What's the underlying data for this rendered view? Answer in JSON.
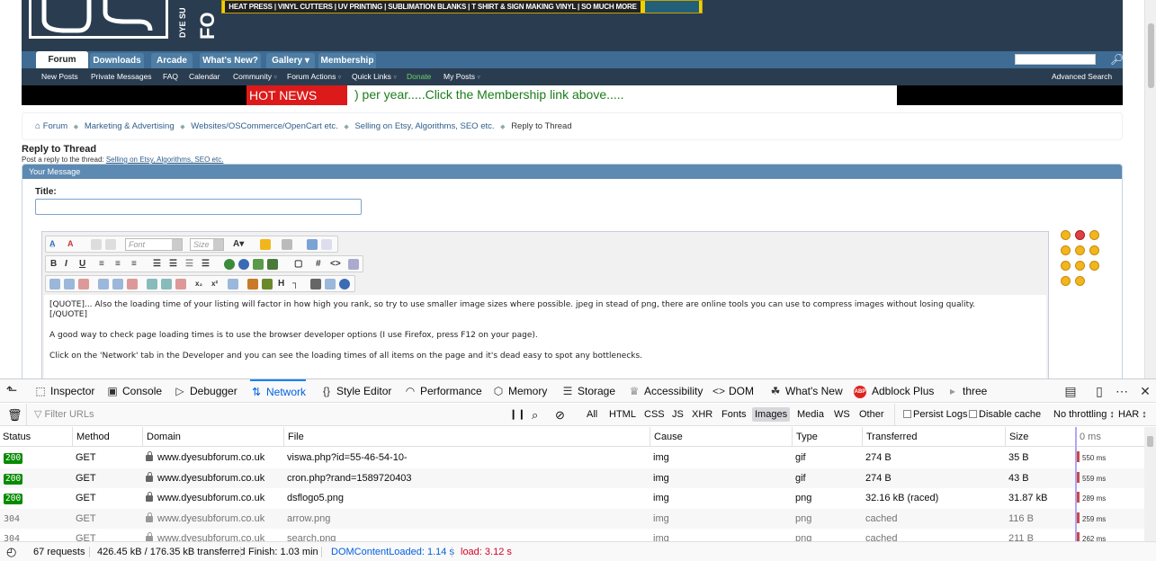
{
  "site": {
    "logo_side_text": "DYE SU",
    "logo_side_big": "FO",
    "banner_text": "HEAT PRESS | VINYL CUTTERS | UV PRINTING | SUBLIMATION BLANKS | T SHIRT & SIGN MAKING VINYL | SO MUCH MORE",
    "nav_tabs": [
      "Forum",
      "Downloads",
      "Arcade",
      "What's New?",
      "Gallery ▾",
      "Membership"
    ],
    "subnav": [
      "New Posts",
      "Private Messages",
      "FAQ",
      "Calendar",
      "Community",
      "Forum Actions",
      "Quick Links",
      "Donate",
      "My Posts"
    ],
    "advanced_search": "Advanced Search",
    "news_label": "HOT NEWS",
    "news_text": ") per year.....Click the Membership link above.....",
    "breadcrumb": [
      "Forum",
      "Marketing & Advertising",
      "Websites/OSCommerce/OpenCart etc.",
      "Selling on Etsy, Algorithms, SEO etc.",
      "Reply to Thread"
    ],
    "reply_title": "Reply to Thread",
    "reply_sub_prefix": "Post a reply to the thread: ",
    "reply_sub_link": "Selling on Etsy, Algorithms, SEO etc.",
    "your_message": "Your Message",
    "title_label": "Title:",
    "title_value": "",
    "font_placeholder": "Font",
    "size_placeholder": "Size",
    "editor_lines": [
      "[QUOTE]... Also the loading time of your listing will factor in how high you rank, so try to use smaller image sizes where possible. jpeg in stead of png, there are online tools you can use to compress images without losing quality.",
      "[/QUOTE]",
      "A good way to check page loading times is to use the browser developer options (I use Firefox, press F12 on your page).",
      "Click on the 'Network' tab in the Developer and you can see the loading times of all items on the page and it's dead easy to spot any bottlenecks."
    ],
    "colors": {
      "header": "#2a3d50",
      "nav": "#3e6c94",
      "hot_news": "#dd1a1a",
      "news_text": "#1b7d1b"
    }
  },
  "devtools": {
    "tabs": [
      {
        "label": "Inspector",
        "icon": "inspector-icon"
      },
      {
        "label": "Console",
        "icon": "console-icon"
      },
      {
        "label": "Debugger",
        "icon": "debugger-icon"
      },
      {
        "label": "Network",
        "icon": "network-icon"
      },
      {
        "label": "Style Editor",
        "icon": "style-editor-icon"
      },
      {
        "label": "Performance",
        "icon": "performance-icon"
      },
      {
        "label": "Memory",
        "icon": "memory-icon"
      },
      {
        "label": "Storage",
        "icon": "storage-icon"
      },
      {
        "label": "Accessibility",
        "icon": "accessibility-icon"
      },
      {
        "label": "DOM",
        "icon": "dom-icon"
      },
      {
        "label": "What's New",
        "icon": "gift-icon"
      },
      {
        "label": "Adblock Plus",
        "icon": "abp-icon",
        "icon_text": "ABP"
      },
      {
        "label": "three",
        "icon": "three-icon"
      }
    ],
    "active_tab": "Network",
    "filter_placeholder": "Filter URLs",
    "type_filters": [
      "All",
      "HTML",
      "CSS",
      "JS",
      "XHR",
      "Fonts",
      "Images",
      "Media",
      "WS",
      "Other"
    ],
    "selected_filter": "Images",
    "persist_logs": "Persist Logs",
    "disable_cache": "Disable cache",
    "throttling": "No throttling ↕",
    "har": "HAR ↕",
    "columns": [
      "Status",
      "Method",
      "Domain",
      "File",
      "Cause",
      "Type",
      "Transferred",
      "Size",
      "0 ms"
    ],
    "requests": [
      {
        "status": "200",
        "method": "GET",
        "domain": "www.dyesubforum.co.uk",
        "file": "viswa.php?id=55-46-54-10-",
        "cause": "img",
        "type": "gif",
        "transferred": "274 B",
        "size": "35 B",
        "timing": "550 ms",
        "cached": false
      },
      {
        "status": "200",
        "method": "GET",
        "domain": "www.dyesubforum.co.uk",
        "file": "cron.php?rand=1589720403",
        "cause": "img",
        "type": "gif",
        "transferred": "274 B",
        "size": "43 B",
        "timing": "559 ms",
        "cached": false
      },
      {
        "status": "200",
        "method": "GET",
        "domain": "www.dyesubforum.co.uk",
        "file": "dsflogo5.png",
        "cause": "img",
        "type": "png",
        "transferred": "32.16 kB (raced)",
        "size": "31.87 kB",
        "timing": "289 ms",
        "cached": false
      },
      {
        "status": "304",
        "method": "GET",
        "domain": "www.dyesubforum.co.uk",
        "file": "arrow.png",
        "cause": "img",
        "type": "png",
        "transferred": "cached",
        "size": "116 B",
        "timing": "259 ms",
        "cached": true
      },
      {
        "status": "304",
        "method": "GET",
        "domain": "www.dyesubforum.co.uk",
        "file": "search.png",
        "cause": "img",
        "type": "png",
        "transferred": "cached",
        "size": "211 B",
        "timing": "262 ms",
        "cached": true
      }
    ],
    "status_bar": {
      "requests": "67 requests",
      "transferred": "426.45 kB / 176.35 kB transferred",
      "finish": "Finish: 1.03 min",
      "dom_loaded": "DOMContentLoaded: 1.14 s",
      "load": "load: 3.12 s"
    },
    "colors": {
      "accent": "#0a84ff",
      "status_ok": "#058b00",
      "dom_loaded": "#0060df",
      "load": "#d70022"
    }
  }
}
